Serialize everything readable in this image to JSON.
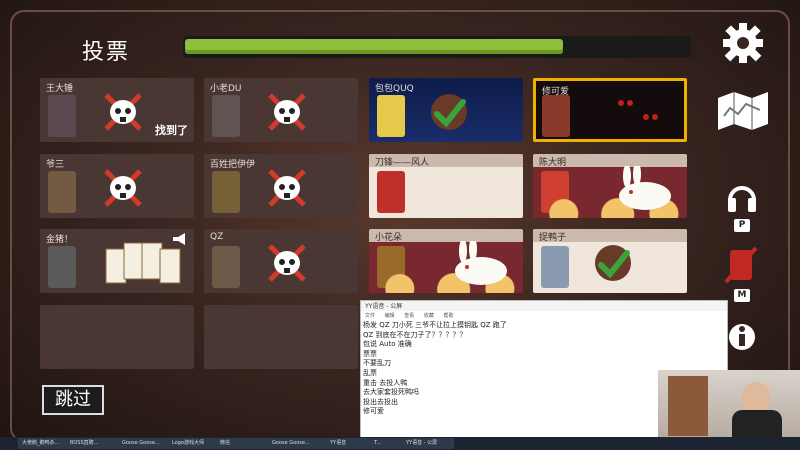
{
  "screen": {
    "title": "投票",
    "timer_fraction": 0.75,
    "skip_label": "跳过"
  },
  "cards": [
    {
      "name": "王大锤",
      "state": "dead",
      "tag": "找到了"
    },
    {
      "name": "小老DU",
      "state": "dead"
    },
    {
      "name": "包包QUQ",
      "state": "voted"
    },
    {
      "name": "修可爱",
      "state": "highlighted"
    },
    {
      "name": "爷三",
      "state": "dead"
    },
    {
      "name": "百姓把伊伊",
      "state": "dead"
    },
    {
      "name": "刀锋——风人",
      "state": "alive"
    },
    {
      "name": "陈大明",
      "state": "alive"
    },
    {
      "name": "金猪！",
      "state": "special"
    },
    {
      "name": "QZ",
      "state": "dead"
    },
    {
      "name": "小花朵",
      "state": "alive"
    },
    {
      "name": "捉鸭子",
      "state": "voted"
    }
  ],
  "sidebar": {
    "settings_icon": "gear-icon",
    "map_icon": "map-icon",
    "headset_key": "P",
    "mute_key": "M"
  },
  "chat": {
    "window_title": "YY语音 - 公屏",
    "menu": [
      "文件",
      "编辑",
      "查看",
      "收藏",
      "帮助"
    ],
    "lines": [
      "杨发 QZ 刀小死 三爷不让拉上摸钥匙 QZ 跑了",
      "QZ 到底在不在刀子了？？？？？",
      "包说 Auto 准确",
      "票票",
      "不要乱刀",
      "乱票",
      "重击 去投人鸭",
      "去大家套投死鸭吗",
      "投出去投出",
      "修可爱"
    ]
  },
  "taskbar": [
    "大佬鹅_鹅鸭杀...",
    "BOSS直聘...",
    "Goose Goose...",
    "Logo游戏大师",
    "微信",
    "Goose Goose...",
    "YY语音",
    "T...",
    "YY语音 - 公屏"
  ],
  "colors": {
    "accent_green": "#8fbf3a",
    "highlight": "#f0b000",
    "x_red": "#d23a2c",
    "check_green": "#3aa43a"
  }
}
